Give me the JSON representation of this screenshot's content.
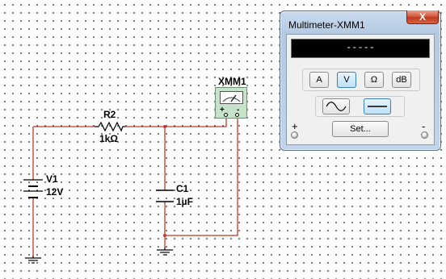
{
  "schematic": {
    "resistor": {
      "ref": "R2",
      "value": "1kΩ"
    },
    "source": {
      "ref": "V1",
      "value": "12V"
    },
    "capacitor": {
      "ref": "C1",
      "value": "1µF"
    },
    "meter_symbol": {
      "ref": "XMM1",
      "plus": "+",
      "minus": "-"
    }
  },
  "multimeter_window": {
    "title": "Multimeter-XMM1",
    "close_label": "X",
    "display_value": "-----",
    "mode_buttons": [
      {
        "label": "A",
        "active": false
      },
      {
        "label": "V",
        "active": true
      },
      {
        "label": "Ω",
        "active": false
      },
      {
        "label": "dB",
        "active": false
      }
    ],
    "signal_buttons": [
      {
        "name": "ac",
        "symbol": "sine-wave-icon",
        "active": false
      },
      {
        "name": "dc",
        "symbol": "dc-line-icon",
        "active": true
      }
    ],
    "set_label": "Set...",
    "plus_terminal_label": "+",
    "minus_terminal_label": "-"
  },
  "colors": {
    "wire": "#c0392b",
    "active_button_border": "#3c7fb1",
    "meter_body": "#c6e3c9",
    "window_frame": "#b4c9e2"
  }
}
